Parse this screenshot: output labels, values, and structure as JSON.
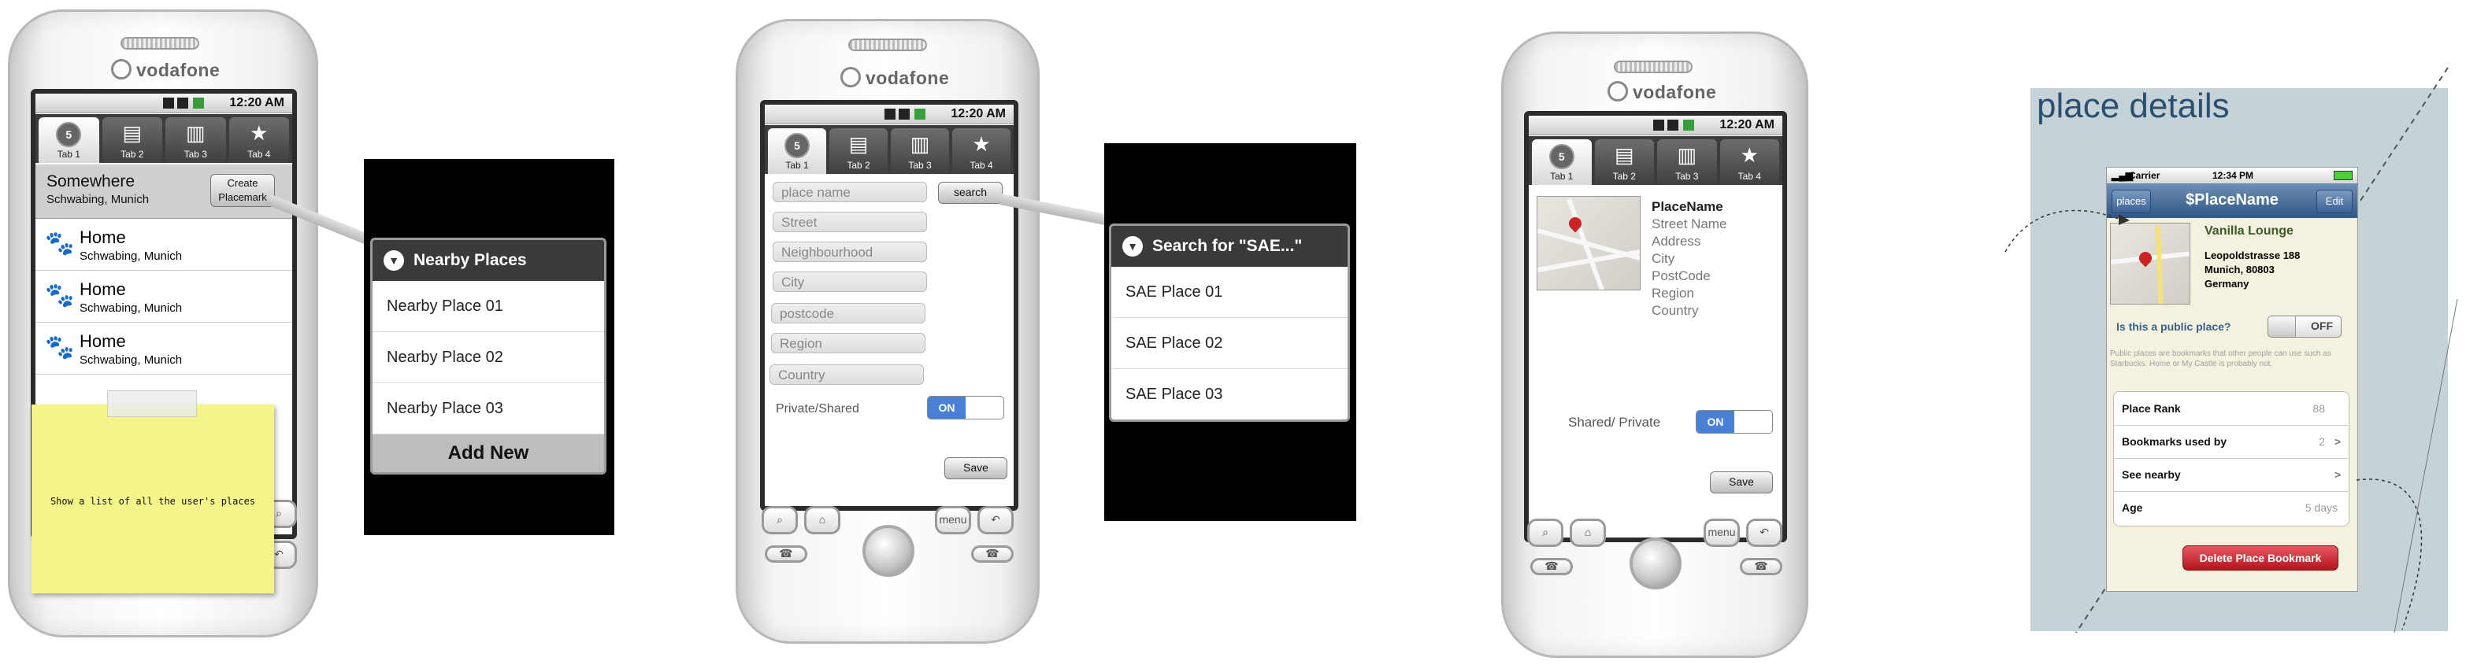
{
  "carrier": "vodafone",
  "status_time": "12:20 AM",
  "tabs": [
    {
      "label": "Tab 1",
      "badge": "5"
    },
    {
      "label": "Tab 2"
    },
    {
      "label": "Tab 3"
    },
    {
      "label": "Tab 4"
    }
  ],
  "hw_keys": {
    "menu": "menu"
  },
  "screen1": {
    "header_title": "Somewhere",
    "header_sub": "Schwabing, Munich",
    "create_button": "Create Placemark",
    "places": [
      {
        "name": "Home",
        "sub": "Schwabing, Munich"
      },
      {
        "name": "Home",
        "sub": "Schwabing, Munich"
      },
      {
        "name": "Home",
        "sub": "Schwabing, Munich"
      }
    ],
    "sticky_note": "Show a list of all the user's places"
  },
  "nearby_popup": {
    "title": "Nearby Places",
    "items": [
      "Nearby Place 01",
      "Nearby Place 02",
      "Nearby Place 03"
    ],
    "add_new": "Add New"
  },
  "screen2": {
    "fields": [
      "place name",
      "Street",
      "Neighbourhood",
      "City",
      "postcode",
      "Region",
      "Country"
    ],
    "search_button": "search",
    "toggle_label": "Private/Shared",
    "toggle_state": "ON",
    "save_button": "Save"
  },
  "search_popup": {
    "title": "Search for \"SAE...\"",
    "items": [
      "SAE Place 01",
      "SAE Place 02",
      "SAE Place 03"
    ]
  },
  "screen3": {
    "lines": [
      "PlaceName",
      "Street Name",
      "Address",
      "City",
      "PostCode",
      "Region",
      "Country"
    ],
    "toggle_label": "Shared/ Private",
    "toggle_state": "ON",
    "save_button": "Save"
  },
  "place_details": {
    "heading": "place details",
    "carrier": "Carrier",
    "time": "12:34 PM",
    "nav_left": "places",
    "nav_title": "$PlaceName",
    "nav_right": "Edit",
    "place_name": "Vanilla Lounge",
    "address_lines": [
      "Leopoldstrasse 188",
      "Munich, 80803",
      "Germany"
    ],
    "public_question": "Is this a public place?",
    "public_toggle": "OFF",
    "public_help": "Public places are bookmarks that other people can use such as Starbucks. Home or My Castle is probably not.",
    "rows": [
      {
        "label": "Place Rank",
        "value": "88",
        "chevron": ""
      },
      {
        "label": "Bookmarks used by",
        "value": "2",
        "chevron": ">"
      },
      {
        "label": "See nearby",
        "value": "",
        "chevron": ">"
      },
      {
        "label": "Age",
        "value": "5 days",
        "chevron": ""
      }
    ],
    "delete_button": "Delete Place Bookmark"
  },
  "colors": {
    "toggle_on": "#4a7fd6",
    "ios_nav": "#2f5685",
    "delete_red": "#cc1f2a",
    "sticky": "#f3f58a"
  }
}
